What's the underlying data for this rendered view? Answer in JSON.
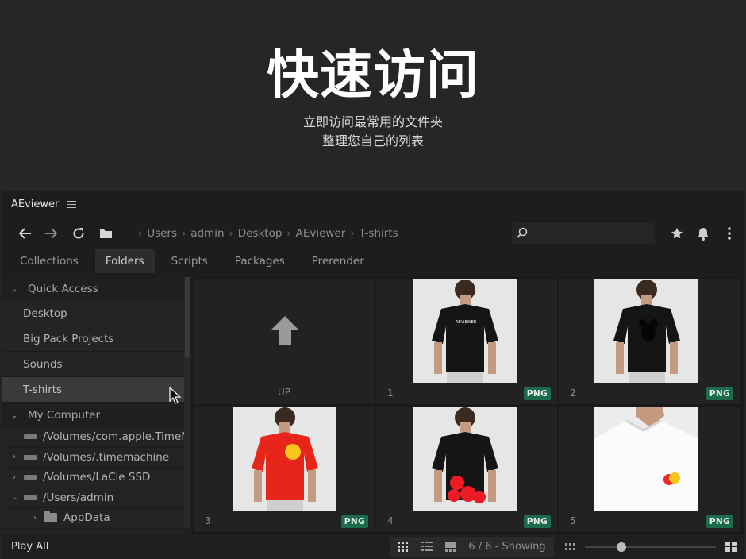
{
  "hero": {
    "title": "快速访问",
    "subtitle_line1": "立即访问最常用的文件夹",
    "subtitle_line2": "整理您自己的列表"
  },
  "app": {
    "name": "AEviewer"
  },
  "breadcrumb": [
    "Users",
    "admin",
    "Desktop",
    "AEviewer",
    "T-shirts"
  ],
  "search": {
    "placeholder": ""
  },
  "tabs": [
    {
      "label": "Collections",
      "active": false
    },
    {
      "label": "Folders",
      "active": true
    },
    {
      "label": "Scripts",
      "active": false
    },
    {
      "label": "Packages",
      "active": false
    },
    {
      "label": "Prerender",
      "active": false
    }
  ],
  "sidebar": {
    "quick_access": {
      "title": "Quick Access",
      "items": [
        "Desktop",
        "Big Pack Projects",
        "Sounds",
        "T-shirts"
      ],
      "selected": "T-shirts"
    },
    "my_computer": {
      "title": "My Computer",
      "items": [
        {
          "label": "/Volumes/com.apple.TimeMachine",
          "expandable": false
        },
        {
          "label": "/Volumes/.timemachine",
          "expandable": true
        },
        {
          "label": "/Volumes/LaCie SSD",
          "expandable": true
        },
        {
          "label": "/Users/admin",
          "expandable": true,
          "expanded": true
        },
        {
          "label": "AppData",
          "expandable": true,
          "child": true
        }
      ]
    }
  },
  "grid": {
    "up_label": "UP",
    "items": [
      {
        "number": "1",
        "badge": "PNG",
        "shirt": "black",
        "print_text": "AEVIEWER"
      },
      {
        "number": "2",
        "badge": "PNG",
        "shirt": "black"
      },
      {
        "number": "3",
        "badge": "PNG",
        "shirt": "red"
      },
      {
        "number": "4",
        "badge": "PNG",
        "shirt": "black"
      },
      {
        "number": "5",
        "badge": "PNG",
        "shirt": "white"
      }
    ]
  },
  "bottom": {
    "play_all": "Play All",
    "showing": "6 / 6 - Showing"
  },
  "colors": {
    "badge": "#1c6b4c",
    "background": "#1d1d1d",
    "hero_background": "#262626"
  }
}
